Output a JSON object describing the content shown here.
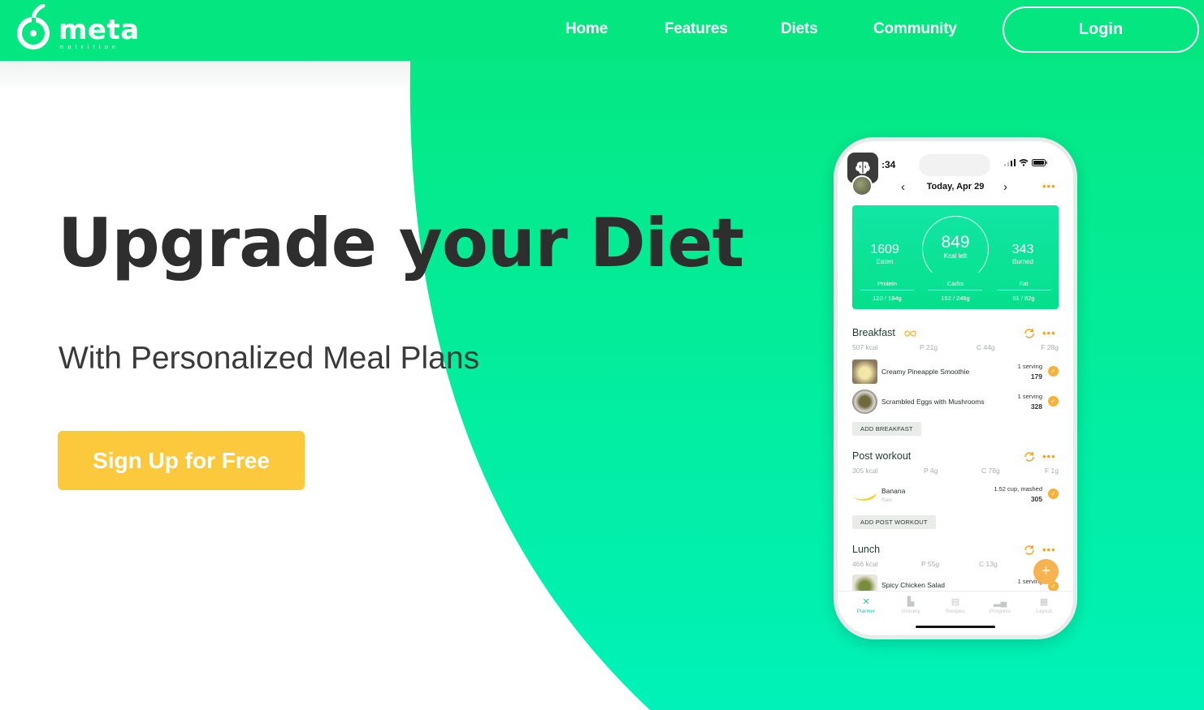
{
  "brand": {
    "name": "meta",
    "tagline": "nutrition",
    "color": "#04e780"
  },
  "nav": {
    "links": [
      "Home",
      "Features",
      "Diets",
      "Community"
    ],
    "login_label": "Login"
  },
  "hero": {
    "title": "Upgrade your Diet",
    "subtitle": "With Personalized Meal Plans",
    "cta_label": "Sign Up for Free",
    "cta_color": "#fcc93d",
    "title_color": "#2e2e2e"
  },
  "phone": {
    "status_time": ":34",
    "date": "Today, Apr 29",
    "summary": {
      "eaten": "1609",
      "eaten_label": "Eaten",
      "kcal_left": "849",
      "kcal_left_label": "Kcal left",
      "burned": "343",
      "burned_label": "Burned",
      "macros": [
        {
          "label": "Protein",
          "value": "120 / 184g"
        },
        {
          "label": "Carbs",
          "value": "152 / 246g"
        },
        {
          "label": "Fat",
          "value": "61 / 82g"
        }
      ]
    },
    "meals": [
      {
        "title": "Breakfast",
        "kcal": "507 kcal",
        "p": "P 21g",
        "c": "C 44g",
        "f": "F 28g",
        "foods": [
          {
            "name": "Creamy Pineapple Smoothie",
            "serving": "1 serving",
            "kcal": "179"
          },
          {
            "name": "Scrambled Eggs with Mushrooms",
            "serving": "1 serving",
            "kcal": "328"
          }
        ],
        "add_label": "ADD BREAKFAST"
      },
      {
        "title": "Post workout",
        "kcal": "305 kcal",
        "p": "P 4g",
        "c": "C 78g",
        "f": "F 1g",
        "foods": [
          {
            "name": "Banana",
            "sub": "Raw",
            "serving": "1.52 cup, mashed",
            "kcal": "305"
          }
        ],
        "add_label": "ADD POST WORKOUT"
      },
      {
        "title": "Lunch",
        "kcal": "466 kcal",
        "p": "P 55g",
        "c": "C 13g",
        "foods": [
          {
            "name": "Spicy Chicken Salad",
            "serving": "1 serving"
          }
        ]
      }
    ],
    "tabs": [
      "Planner",
      "Grocery",
      "Recipes",
      "Progress",
      "Layout"
    ],
    "fab_label": "+"
  }
}
